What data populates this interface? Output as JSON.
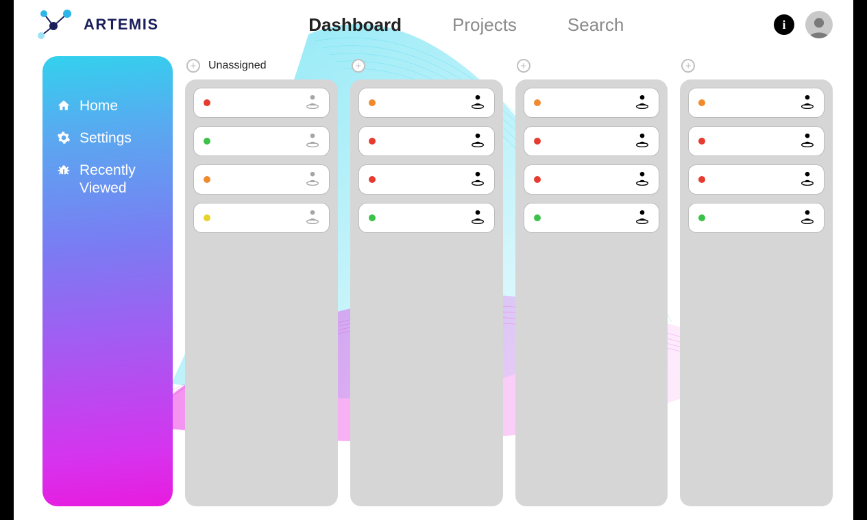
{
  "brand": "ARTEMIS",
  "nav": {
    "items": [
      {
        "label": "Dashboard",
        "active": true
      },
      {
        "label": "Projects",
        "active": false
      },
      {
        "label": "Search",
        "active": false
      }
    ]
  },
  "info_glyph": "i",
  "sidebar": {
    "items": [
      {
        "label": "Home",
        "icon": "home-icon"
      },
      {
        "label": "Settings",
        "icon": "gear-icon"
      },
      {
        "label": "Recently Viewed",
        "icon": "bug-icon"
      }
    ]
  },
  "status_colors": {
    "red": "#e63b2e",
    "green": "#3cc24a",
    "orange": "#f08a2c",
    "yellow": "#e8d32a"
  },
  "board": {
    "columns": [
      {
        "title": "Unassigned",
        "show_title": true,
        "cards": [
          {
            "status": "red",
            "assigned": false
          },
          {
            "status": "green",
            "assigned": false
          },
          {
            "status": "orange",
            "assigned": false
          },
          {
            "status": "yellow",
            "assigned": false
          }
        ]
      },
      {
        "title": "",
        "show_title": false,
        "cards": [
          {
            "status": "orange",
            "assigned": true
          },
          {
            "status": "red",
            "assigned": true
          },
          {
            "status": "red",
            "assigned": true
          },
          {
            "status": "green",
            "assigned": true
          }
        ]
      },
      {
        "title": "",
        "show_title": false,
        "cards": [
          {
            "status": "orange",
            "assigned": true
          },
          {
            "status": "red",
            "assigned": true
          },
          {
            "status": "red",
            "assigned": true
          },
          {
            "status": "green",
            "assigned": true
          }
        ]
      },
      {
        "title": "",
        "show_title": false,
        "cards": [
          {
            "status": "orange",
            "assigned": true
          },
          {
            "status": "red",
            "assigned": true
          },
          {
            "status": "red",
            "assigned": true
          },
          {
            "status": "green",
            "assigned": true
          }
        ]
      }
    ]
  }
}
